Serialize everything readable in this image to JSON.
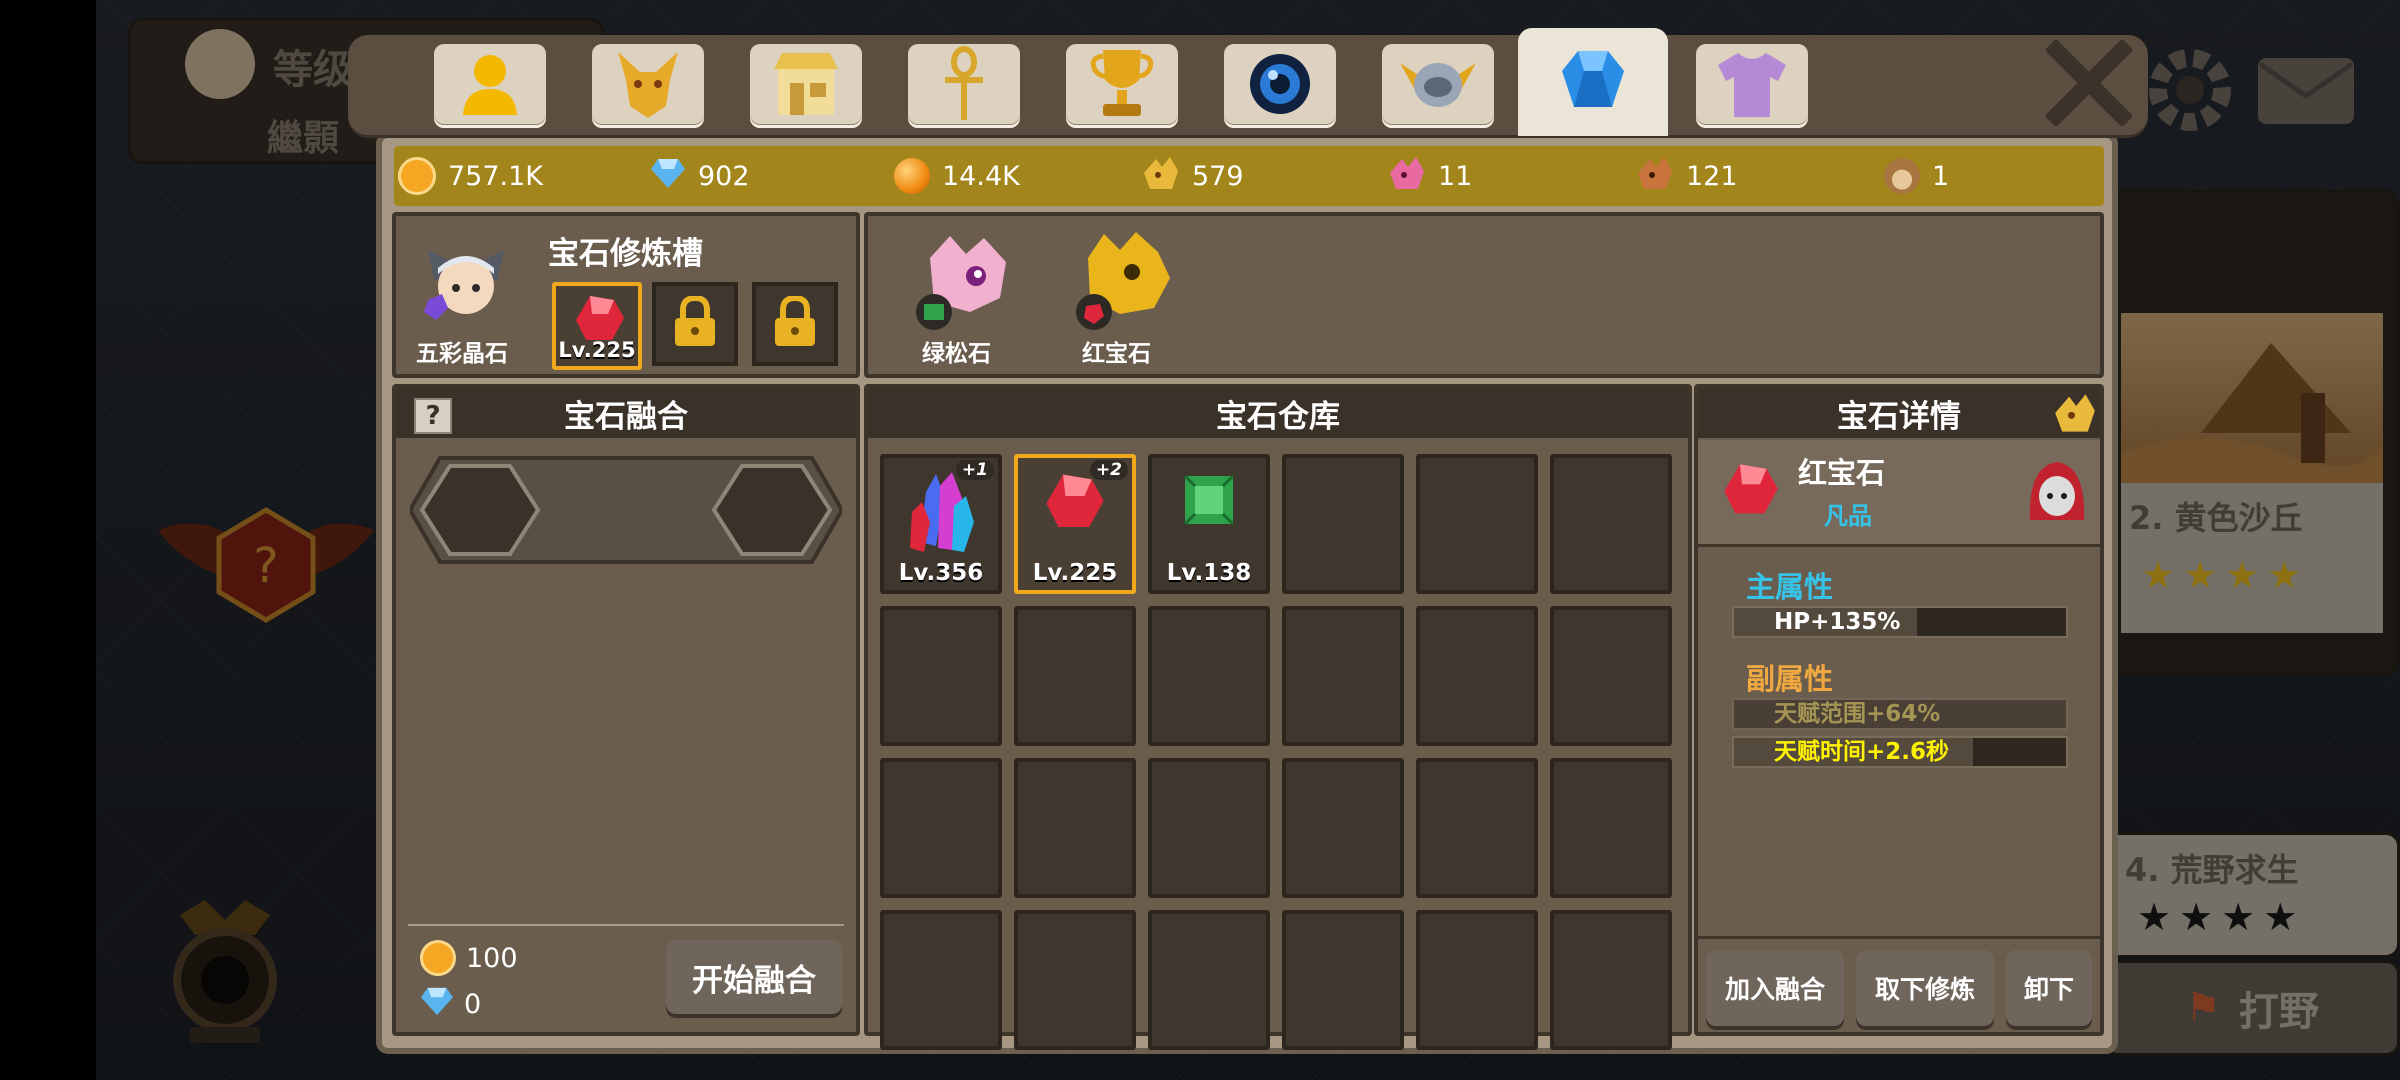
{
  "background": {
    "player_level_label": "等级",
    "player_name": "繼顥",
    "stage_list": [
      {
        "label": "2. 黄色沙丘",
        "stars": 4,
        "star_color": "#f2c21e"
      },
      {
        "label": "4. 荒野求生",
        "stars": 4,
        "star_color": "#1a1a1a"
      }
    ],
    "wild_button": "打野"
  },
  "tabs": [
    {
      "name": "hero-icon",
      "active": false
    },
    {
      "name": "dragon-head-icon",
      "active": false
    },
    {
      "name": "shop-icon",
      "active": false
    },
    {
      "name": "ankh-icon",
      "active": false
    },
    {
      "name": "trophy-icon",
      "active": false
    },
    {
      "name": "orb-icon",
      "active": false
    },
    {
      "name": "winged-helmet-icon",
      "active": false
    },
    {
      "name": "gem-icon",
      "active": true
    },
    {
      "name": "shirt-icon",
      "active": false
    }
  ],
  "resources": [
    {
      "icon": "gold-coin-icon",
      "value": "757.1K",
      "color": "#f5a623"
    },
    {
      "icon": "diamond-icon",
      "value": "902",
      "color": "#5ab4f0"
    },
    {
      "icon": "orange-orb-icon",
      "value": "14.4K",
      "color": "#f08a10"
    },
    {
      "icon": "yellow-dragon-icon",
      "value": "579",
      "color": "#e8b93a"
    },
    {
      "icon": "pink-dragon-icon",
      "value": "11",
      "color": "#e86aa0"
    },
    {
      "icon": "brown-dragon-icon",
      "value": "121",
      "color": "#c9743d"
    },
    {
      "icon": "monkey-face-icon",
      "value": "1",
      "color": "#a8743f"
    }
  ],
  "refine": {
    "title": "宝石修炼槽",
    "hero_gem_label": "五彩晶石",
    "slot_level": "Lv.225",
    "pets": [
      {
        "label": "绿松石",
        "color": "#f2b0cf"
      },
      {
        "label": "红宝石",
        "color": "#e9b51b"
      }
    ]
  },
  "fusion": {
    "title": "宝石融合",
    "help": "?",
    "gold_cost": "100",
    "diamond_cost": "0",
    "start_button": "开始融合"
  },
  "warehouse": {
    "title": "宝石仓库",
    "items": [
      {
        "level": "Lv.356",
        "plus": "+1",
        "gem": "crystal-cluster-icon",
        "selected": false
      },
      {
        "level": "Lv.225",
        "plus": "+2",
        "gem": "ruby-icon",
        "selected": true
      },
      {
        "level": "Lv.138",
        "plus": "",
        "gem": "emerald-icon",
        "selected": false
      }
    ],
    "total_slots": 24
  },
  "detail": {
    "title": "宝石详情",
    "gem_name": "红宝石",
    "grade": "凡品",
    "main_attr_title": "主属性",
    "main_attr": "HP+135%",
    "main_attr_fill": 0.55,
    "sub_attr_title": "副属性",
    "sub_attrs": [
      {
        "text": "天赋范围+64%",
        "active": false
      },
      {
        "text": "天赋时间+2.6秒",
        "active": true
      }
    ],
    "buttons": {
      "add_fusion": "加入融合",
      "remove_refine": "取下修炼",
      "unequip": "卸下"
    }
  },
  "colors": {
    "accent_gold": "#f0a81c",
    "main_attr": "#35c4e8",
    "sub_attr": "#f0a840",
    "grade": "#35c4e8"
  }
}
